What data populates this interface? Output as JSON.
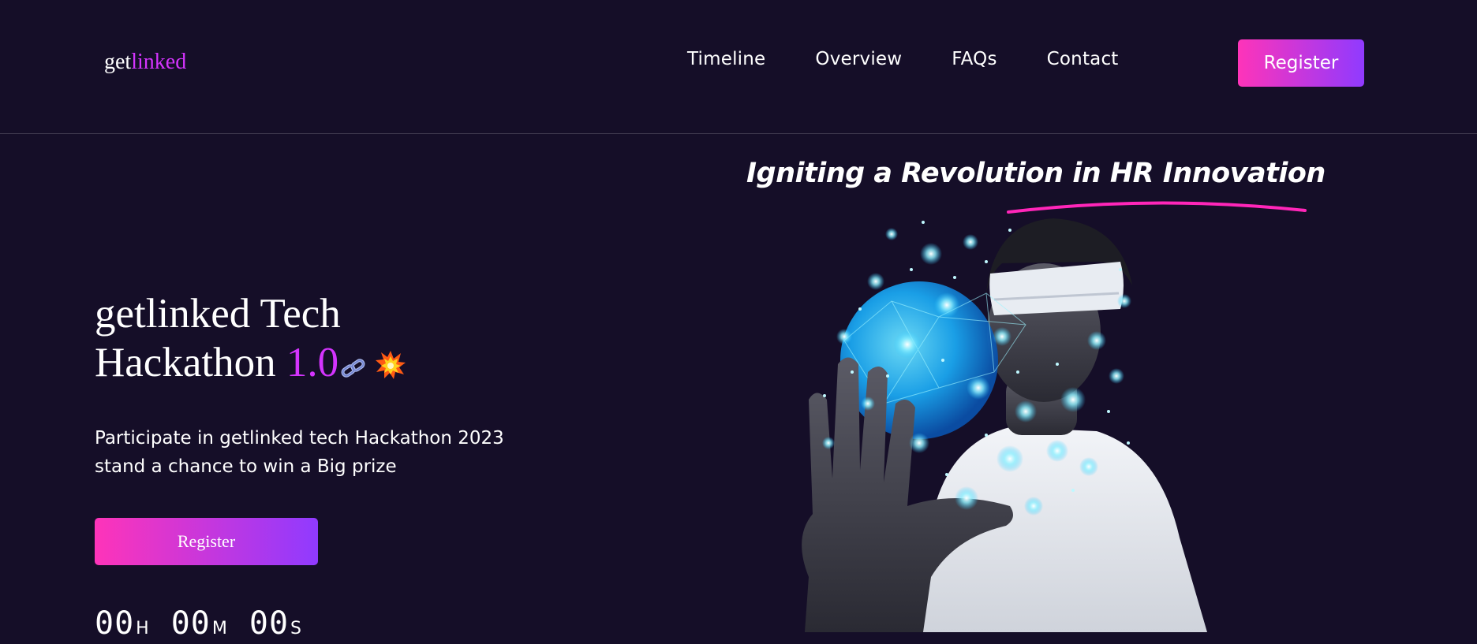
{
  "header": {
    "logo_main": "get",
    "logo_accent": "linked",
    "nav": [
      "Timeline",
      "Overview",
      "FAQs",
      "Contact"
    ],
    "register_label": "Register"
  },
  "hero": {
    "title_line1": "getlinked Tech",
    "title_line2": "Hackathon ",
    "title_version": "1.0",
    "subtitle_line1": "Participate in getlinked tech Hackathon 2023",
    "subtitle_line2": "stand a chance to win a Big prize",
    "register_label": "Register",
    "countdown": [
      {
        "value": "00",
        "unit": "H"
      },
      {
        "value": "00",
        "unit": "M"
      },
      {
        "value": "00",
        "unit": "S"
      }
    ],
    "tagline": "Igniting a Revolution in HR Innovation",
    "image_icon": "vr-person-hologram-image"
  },
  "colors": {
    "background": "#150e28",
    "accent_purple": "#d434fe",
    "gradient_start": "#fe34b9",
    "gradient_end": "#903aff",
    "underline_pink": "#ff26b9"
  },
  "icons": [
    "chain-link-icon",
    "explosion-icon"
  ]
}
